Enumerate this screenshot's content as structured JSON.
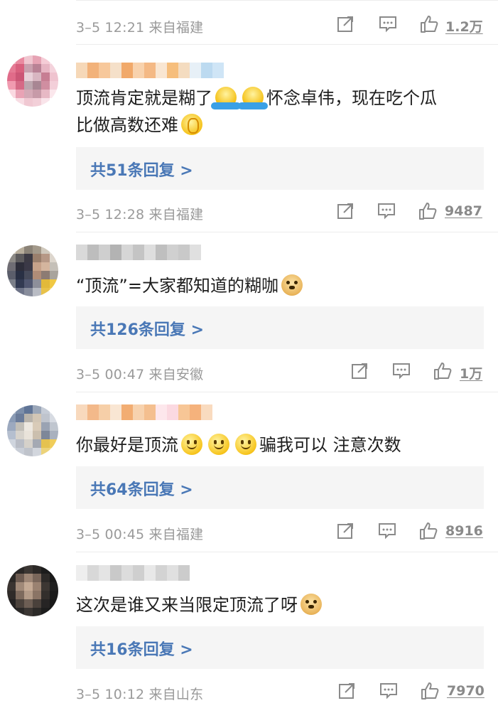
{
  "comments": [
    {
      "meta": {
        "time": "3–5 12:21 来自福建",
        "likes": "1.2万"
      }
    },
    {
      "text_a": "顶流肯定就是糊了",
      "text_b": "怀念卓伟，现在吃个瓜",
      "text_c": "比做高数还难",
      "reply": "共51条回复 >",
      "meta": {
        "time": "3–5 12:28 来自福建",
        "likes": "9487"
      }
    },
    {
      "text_a": "“顶流”=大家都知道的糊咖",
      "reply": "共126条回复 >",
      "meta": {
        "time": "3–5 00:47 来自安徽",
        "likes": "1万"
      }
    },
    {
      "text_a": "你最好是顶流",
      "text_b": "骗我可以 注意次数",
      "reply": "共64条回复 >",
      "meta": {
        "time": "3–5 00:45 来自福建",
        "likes": "8916"
      }
    },
    {
      "text_a": "这次是谁又来当限定顶流了呀",
      "reply": "共16条回复 >",
      "meta": {
        "time": "3–5 10:12 来自山东",
        "likes": "7970"
      }
    }
  ],
  "icons": {
    "share": "share-icon",
    "comment": "comment-icon",
    "like": "thumbs-up-icon"
  },
  "colors": {
    "link": "#4a78b6",
    "meta": "#9a9a9a",
    "reply_bg": "#f5f5f5"
  }
}
